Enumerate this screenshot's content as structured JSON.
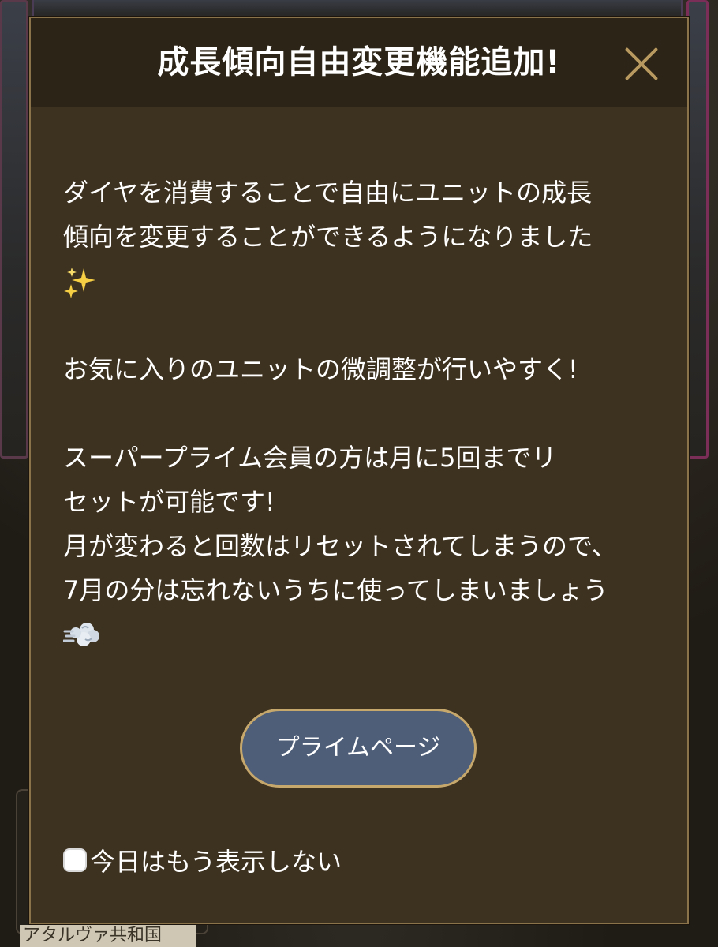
{
  "modal": {
    "title": "成長傾向自由変更機能追加!",
    "close_icon": "close-icon",
    "body": {
      "paragraph1": {
        "line1": "ダイヤを消費することで自由にユニットの成長",
        "line2": "傾向を変更することができるようになりました",
        "emoji_icon": "sparkles-icon"
      },
      "paragraph2": {
        "line1": "お気に入りのユニットの微調整が行いやすく!"
      },
      "paragraph3": {
        "line1": "スーパープライム会員の方は月に5回までリ",
        "line2": "セットが可能です!",
        "line3": "月が変わると回数はリセットされてしまうので、",
        "line4": "7月の分は忘れないうちに使ってしまいましょう",
        "emoji_icon": "dash-icon"
      }
    },
    "prime_button_label": "プライムページ",
    "dont_show_label": "今日はもう表示しない",
    "dont_show_checked": false
  },
  "background": {
    "footer_label": "アタルヴァ共和国"
  },
  "colors": {
    "modal_bg": "#3d311f",
    "header_bg": "#2c2416",
    "border_gold": "#8a734a",
    "button_bg": "#4e5e78",
    "button_border": "#c7a86c",
    "close_icon": "#b89a60"
  }
}
